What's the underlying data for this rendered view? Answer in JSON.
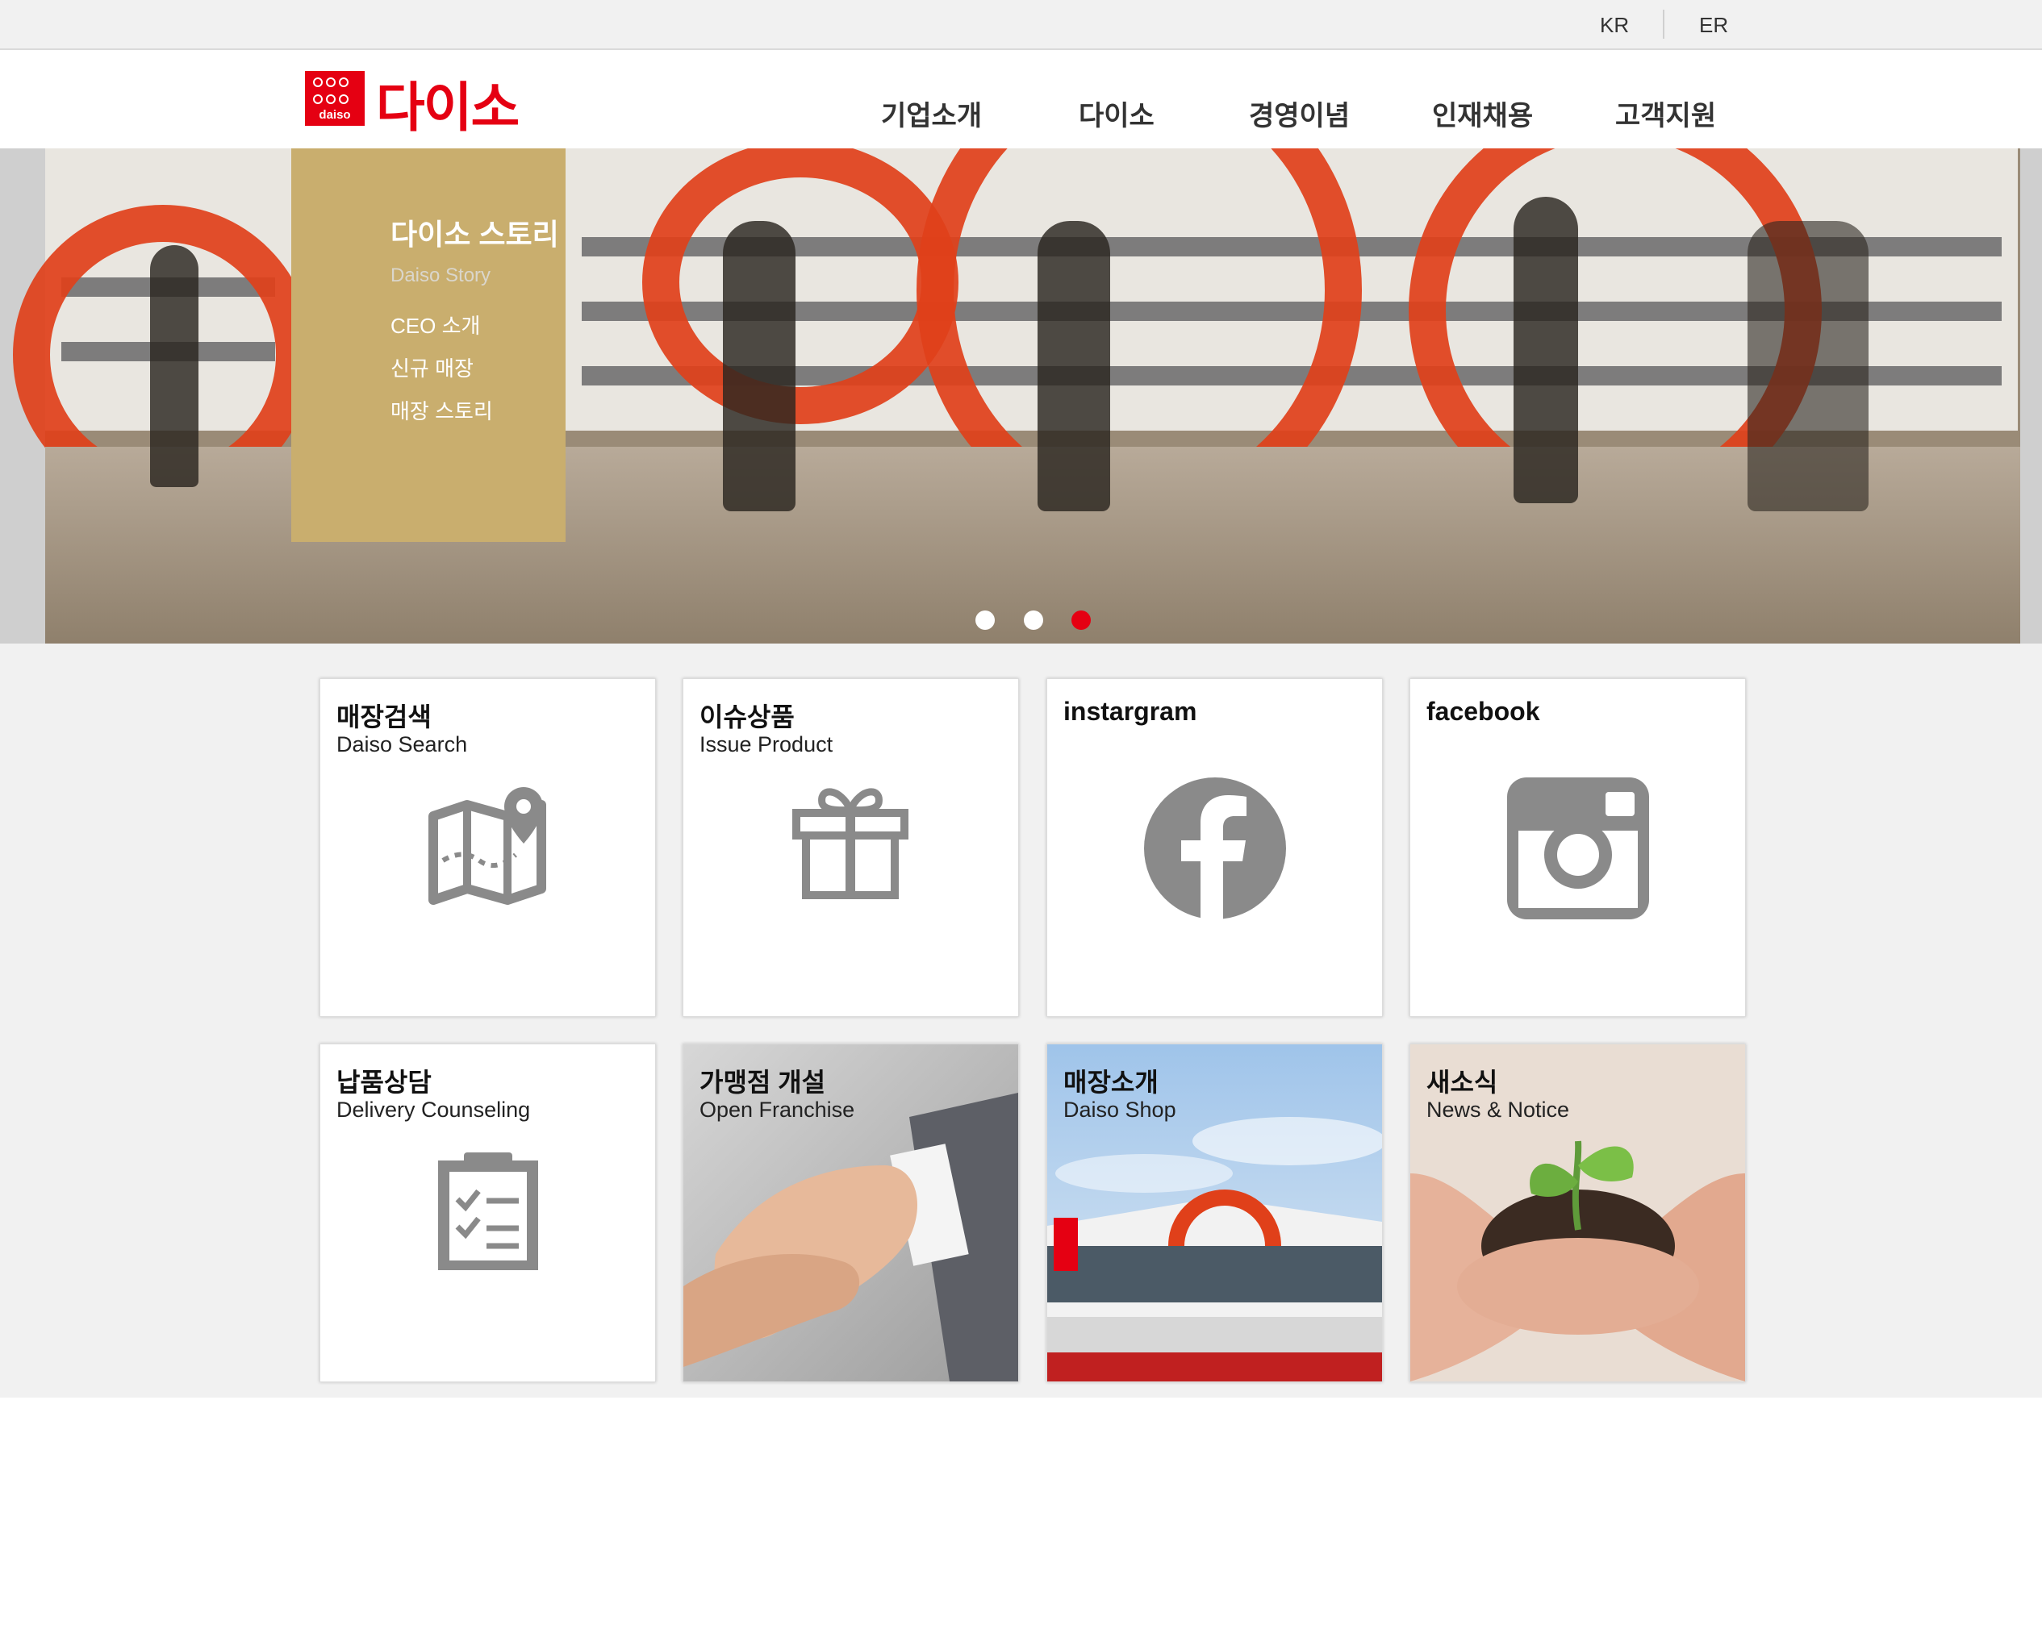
{
  "lang_bar": {
    "items": [
      "KR",
      "ER"
    ]
  },
  "header": {
    "logo_mark_text": "daiso",
    "logo_text": "다이소",
    "nav": [
      "기업소개",
      "다이소",
      "경영이념",
      "인재채용",
      "고객지원"
    ]
  },
  "hero": {
    "title": "다이소 스토리",
    "subtitle": "Daiso Story",
    "links": [
      "CEO 소개",
      "신규 매장",
      "매장 스토리"
    ],
    "slides_total": 3,
    "active_slide": 3,
    "colors": {
      "active_dot": "#e50012",
      "inactive_dot": "#ffffff"
    }
  },
  "cards": [
    {
      "title": "매장검색",
      "sub": "Daiso Search",
      "icon": "map-pin-icon"
    },
    {
      "title": "이슈상품",
      "sub": "Issue Product",
      "icon": "gift-icon"
    },
    {
      "title": "instargram",
      "sub": "",
      "icon": "facebook-icon"
    },
    {
      "title": "facebook",
      "sub": "",
      "icon": "instagram-icon"
    },
    {
      "title": "납품상담",
      "sub": "Delivery Counseling",
      "icon": "clipboard-checklist-icon"
    },
    {
      "title": "가맹점 개설",
      "sub": "Open Franchise",
      "icon": "handshake-photo"
    },
    {
      "title": "매장소개",
      "sub": "Daiso Shop",
      "icon": "store-building-photo"
    },
    {
      "title": "새소식",
      "sub": "News & Notice",
      "icon": "seedling-hands-photo"
    }
  ],
  "colors": {
    "brand": "#e50012",
    "icon_gray": "#8a8a8a",
    "content_bg": "#f1f1f1"
  }
}
